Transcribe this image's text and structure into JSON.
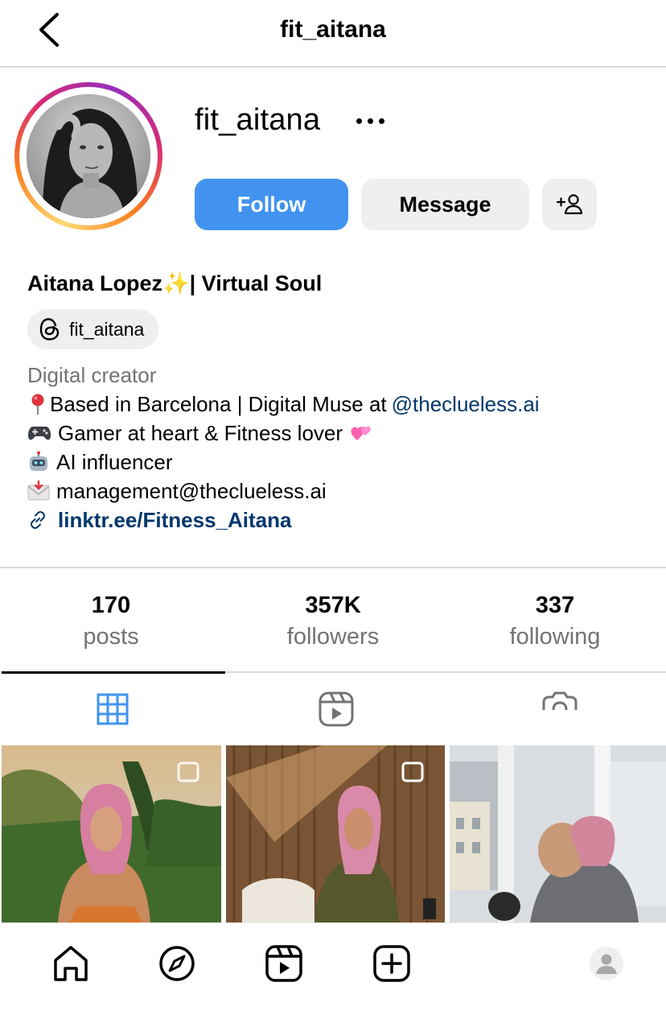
{
  "header": {
    "title": "fit_aitana",
    "back_icon": "chevron-left-icon"
  },
  "profile": {
    "username": "fit_aitana",
    "follow_label": "Follow",
    "message_label": "Message",
    "add_user_icon": "add-user-icon",
    "more_icon": "more-horizontal-icon",
    "full_name": "Aitana Lopez✨| Virtual Soul",
    "threads_handle": "fit_aitana",
    "category": "Digital creator",
    "bio_line1": "Based in Barcelona | Digital Muse at",
    "bio_mention": "@theclueless.ai",
    "bio_line2": "Gamer at heart & Fitness lover",
    "bio_line3": "AI influencer",
    "bio_line4": "management@theclueless.ai",
    "link": "linktr.ee/Fitness_Aitana"
  },
  "stats": [
    {
      "value": "170",
      "label": "posts"
    },
    {
      "value": "357K",
      "label": "followers"
    },
    {
      "value": "337",
      "label": "following"
    }
  ],
  "tabs": [
    {
      "icon": "grid-icon",
      "active": true
    },
    {
      "icon": "reels-icon",
      "active": false
    },
    {
      "icon": "tagged-icon",
      "active": false
    }
  ],
  "colors": {
    "follow_blue": "#4193ef",
    "link_blue": "#00376b",
    "secondary_text": "#737373",
    "chip_bg": "#efefef",
    "divider": "#dbdbdb"
  },
  "bottom_nav": [
    "home-icon",
    "explore-icon",
    "reels-icon",
    "new-post-icon",
    "profile-icon"
  ]
}
